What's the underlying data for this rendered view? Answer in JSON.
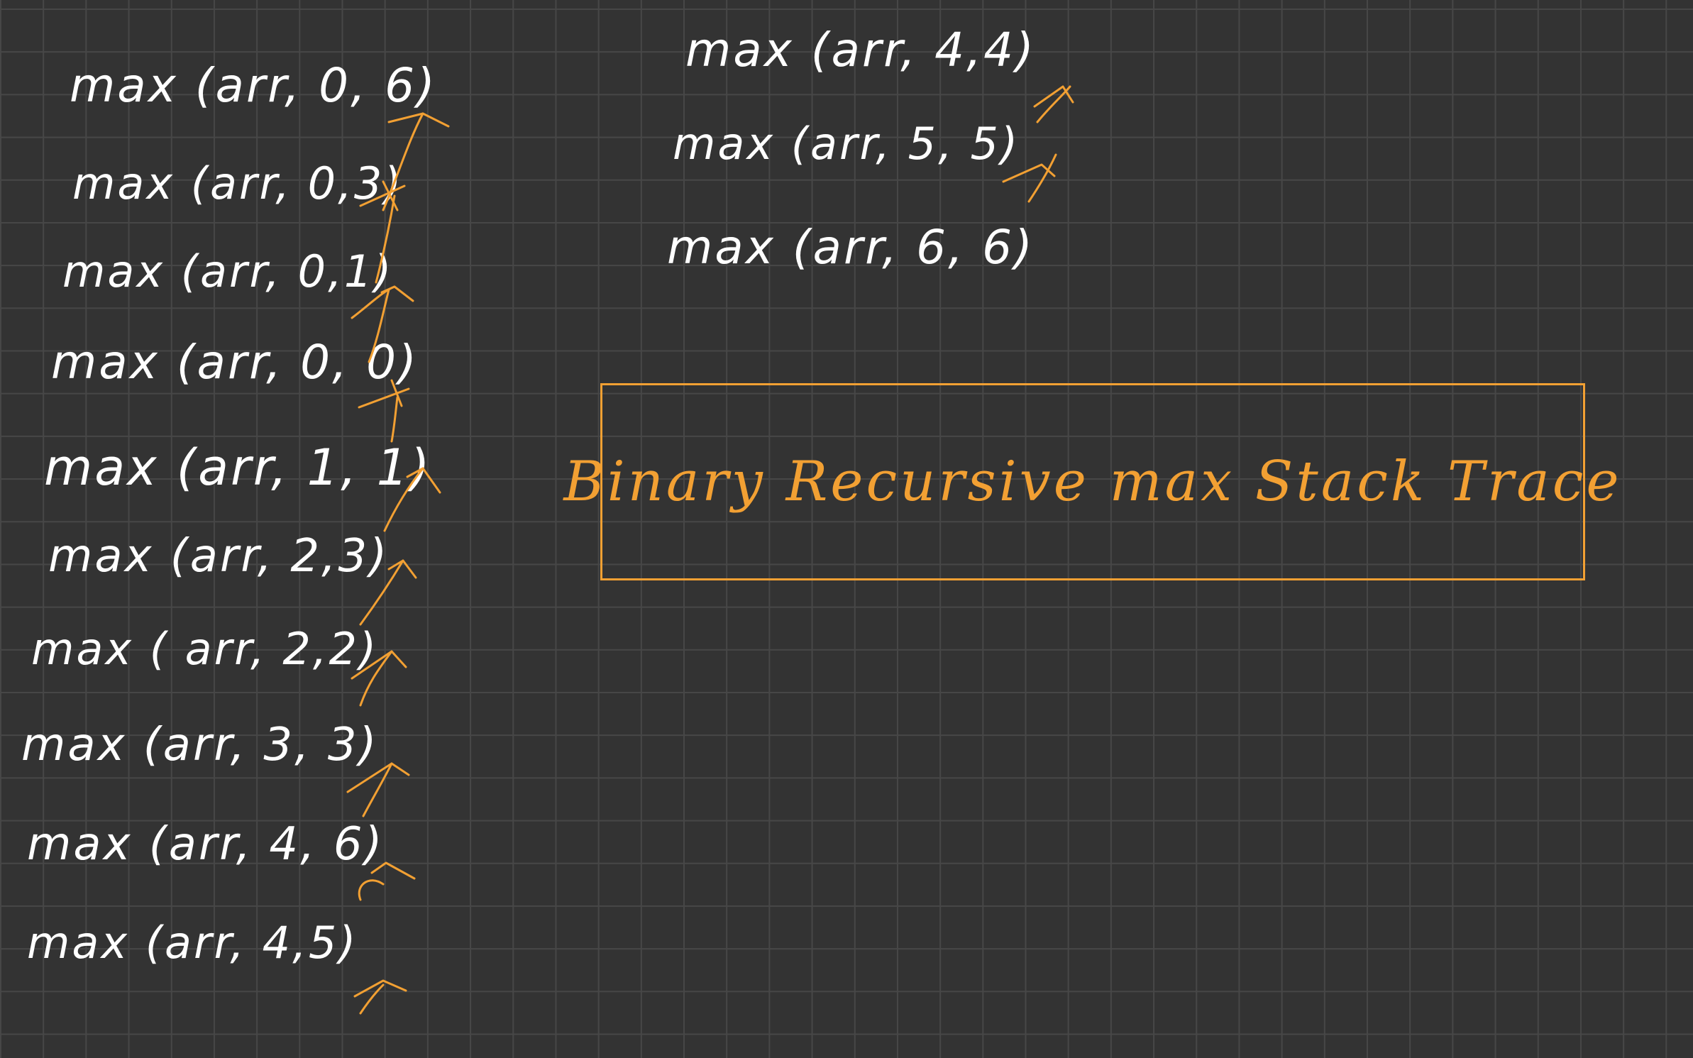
{
  "title": "Binary Recursive max Stack Trace",
  "left_column_calls": [
    "max (arr, 0, 6)",
    "max (arr, 0,3)",
    "max (arr, 0,1)",
    "max (arr, 0, 0)",
    "max (arr, 1, 1)",
    "max (arr, 2,3)",
    "max ( arr, 2,2)",
    "max (arr, 3, 3)",
    "max (arr, 4, 6)",
    "max (arr, 4,5)"
  ],
  "right_column_calls": [
    "max (arr, 4,4)",
    "max (arr, 5, 5)",
    "max (arr, 6, 6)"
  ],
  "colors": {
    "background": "#333333",
    "grid": "#474747",
    "ink": "#ffffff",
    "accent": "#f2a033"
  }
}
